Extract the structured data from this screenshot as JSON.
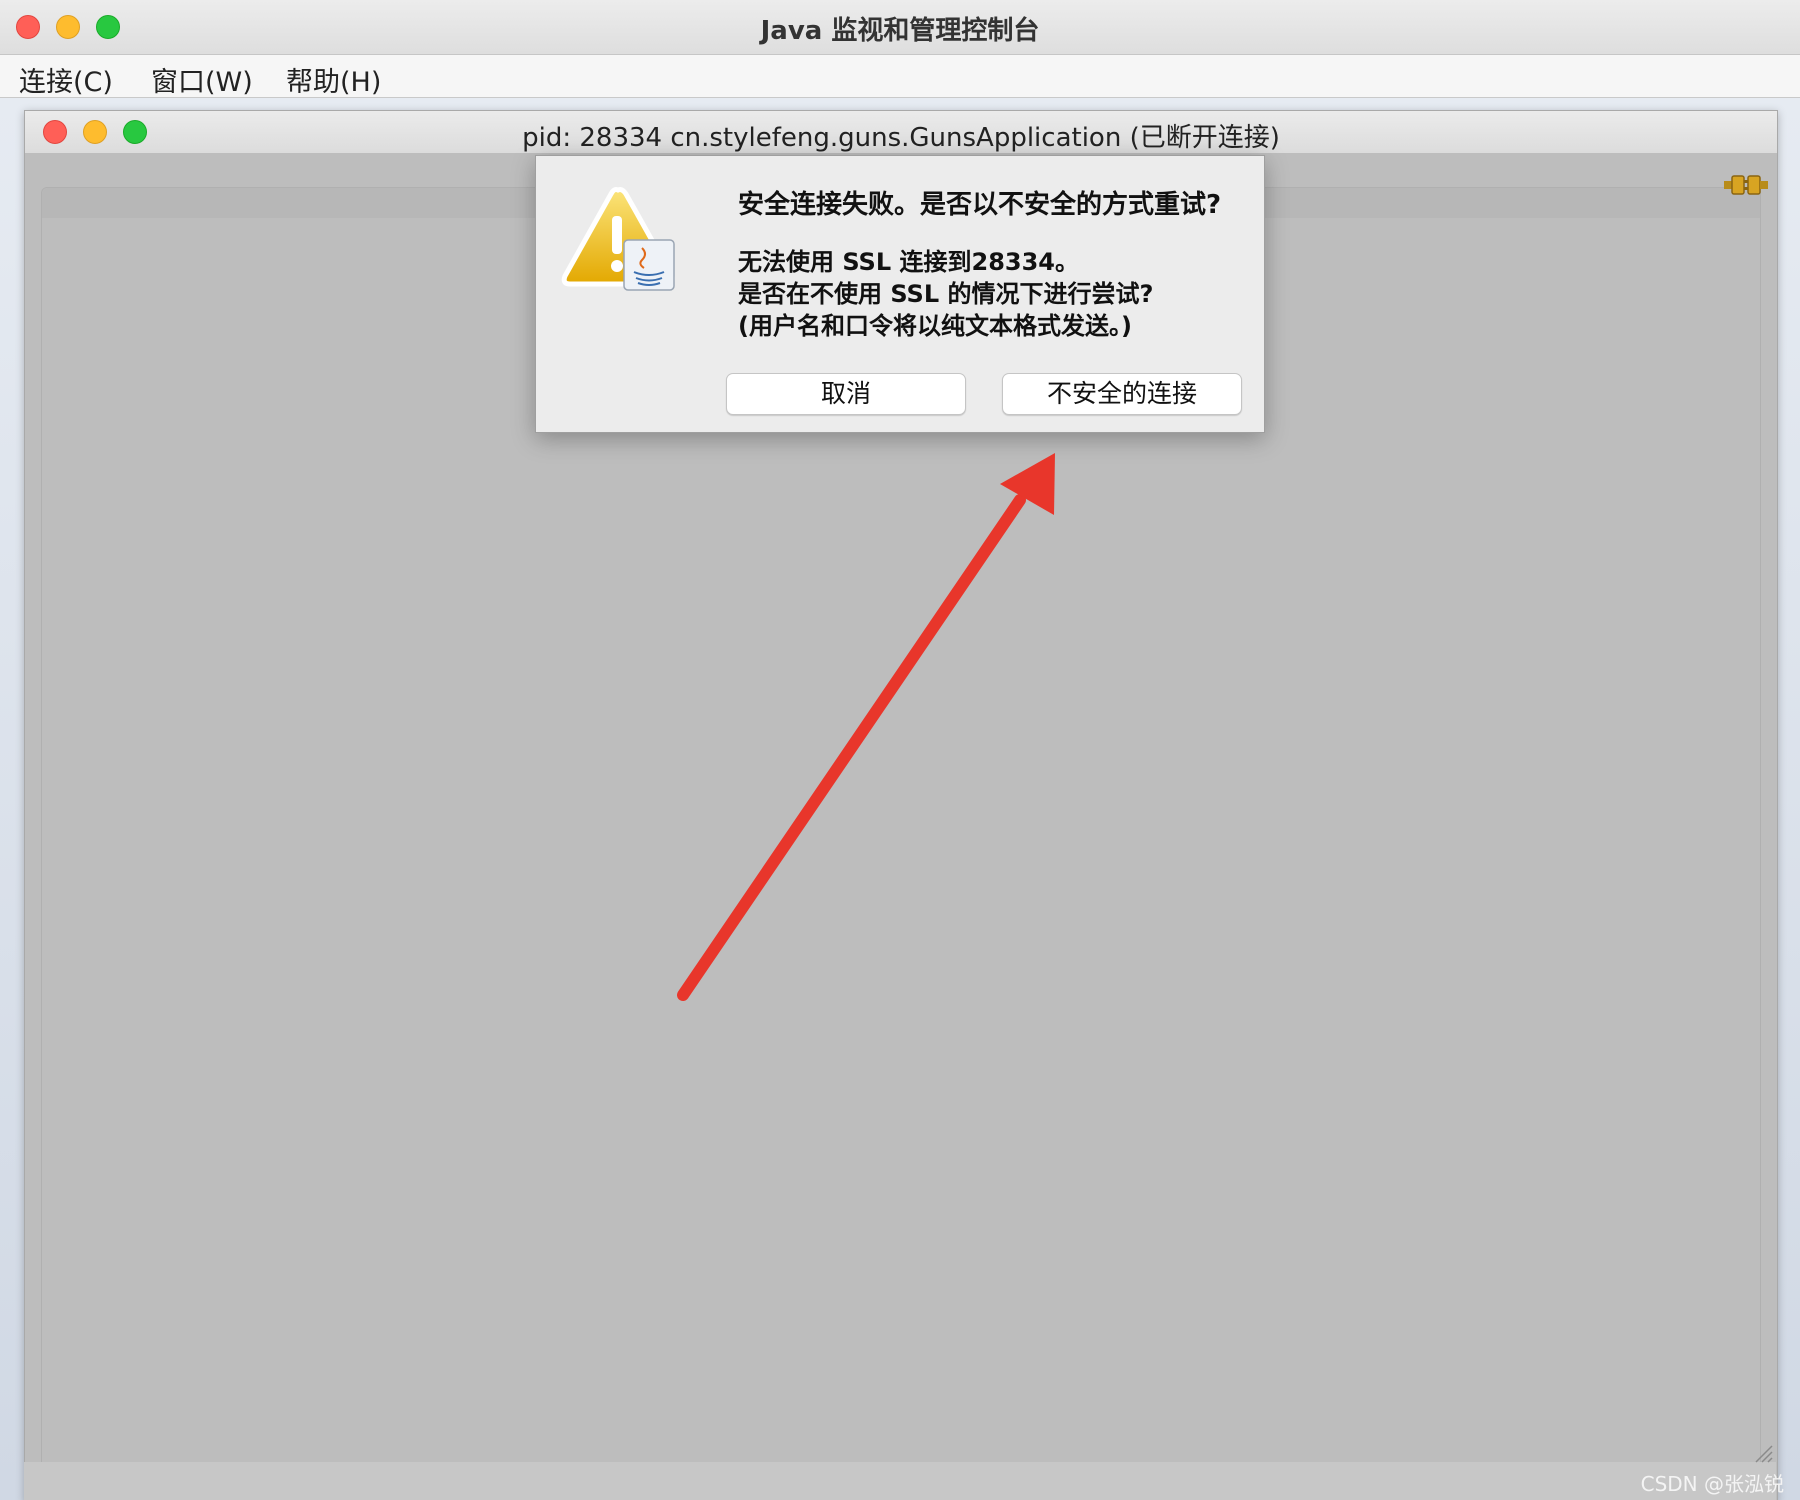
{
  "window": {
    "title": "Java 监视和管理控制台"
  },
  "menubar": {
    "items": [
      {
        "label": "连接(C)"
      },
      {
        "label": "窗口(W)"
      },
      {
        "label": "帮助(H)"
      }
    ]
  },
  "inner_window": {
    "title": "pid: 28334 cn.stylefeng.guns.GunsApplication (已断开连接)"
  },
  "dialog": {
    "heading": "安全连接失败。是否以不安全的方式重试?",
    "message_lines": [
      "无法使用 SSL 连接到28334。",
      "是否在不使用 SSL 的情况下进行尝试?",
      "(用户名和口令将以纯文本格式发送。)"
    ],
    "buttons": {
      "cancel": "取消",
      "insecure_connect": "不安全的连接"
    },
    "icon": "warning-java-icon"
  },
  "annotation": {
    "arrow_color": "#e8362b"
  },
  "watermark": "CSDN @张泓锐",
  "colors": {
    "content_gray": "#bdbdbd",
    "dialog_bg": "#ececec"
  }
}
